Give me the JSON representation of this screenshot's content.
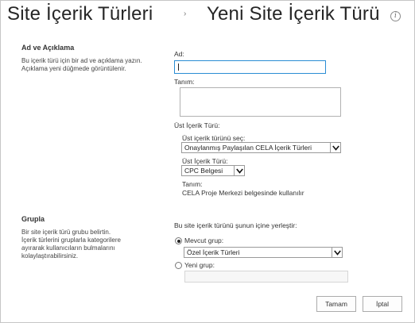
{
  "header": {
    "breadcrumb_parent": "Site İçerik Türleri",
    "separator": "›",
    "page_title": "Yeni Site İçerik Türü",
    "info_icon_glyph": "i"
  },
  "name_section": {
    "title": "Ad ve Açıklama",
    "description_line1": "Bu içerik türü için bir ad ve açıklama yazın.",
    "description_line2": "Açıklama yeni düğmede görüntülenir.",
    "name_label": "Ad:",
    "name_value": "",
    "description_label": "Tanım:",
    "description_value": "",
    "parent_type_label": "Üst İçerik Türü:",
    "select_parent_label": "Üst içerik türünü seç:",
    "parent_group_selected": "Onaylanmış Paylaşılan CELA İçerik Türleri",
    "parent_type_sublabel": "Üst İçerik Türü:",
    "parent_type_selected": "CPC Belgesi",
    "parent_desc_label": "Tanım:",
    "parent_desc_text": "CELA Proje Merkezi belgesinde kullanılır"
  },
  "group_section": {
    "title": "Grupla",
    "description_line1": "Bir site içerik türü grubu belirtin.",
    "description_line2": "İçerik türlerini gruplarla kategorilere",
    "description_line3": "ayırarak kullanıcıların bulmalarını",
    "description_line4": "kolaylaştırabilirsiniz.",
    "put_in_label": "Bu site içerik türünü şunun içine yerleştir:",
    "existing_group_label": "Mevcut grup:",
    "existing_group_selected": "Özel İçerik Türleri",
    "new_group_label": "Yeni grup:",
    "new_group_value": "",
    "existing_group_checked": true
  },
  "buttons": {
    "ok_label": "Tamam",
    "cancel_label": "İptal"
  },
  "colors": {
    "focus_border": "#2a8dd4",
    "text": "#333333"
  }
}
